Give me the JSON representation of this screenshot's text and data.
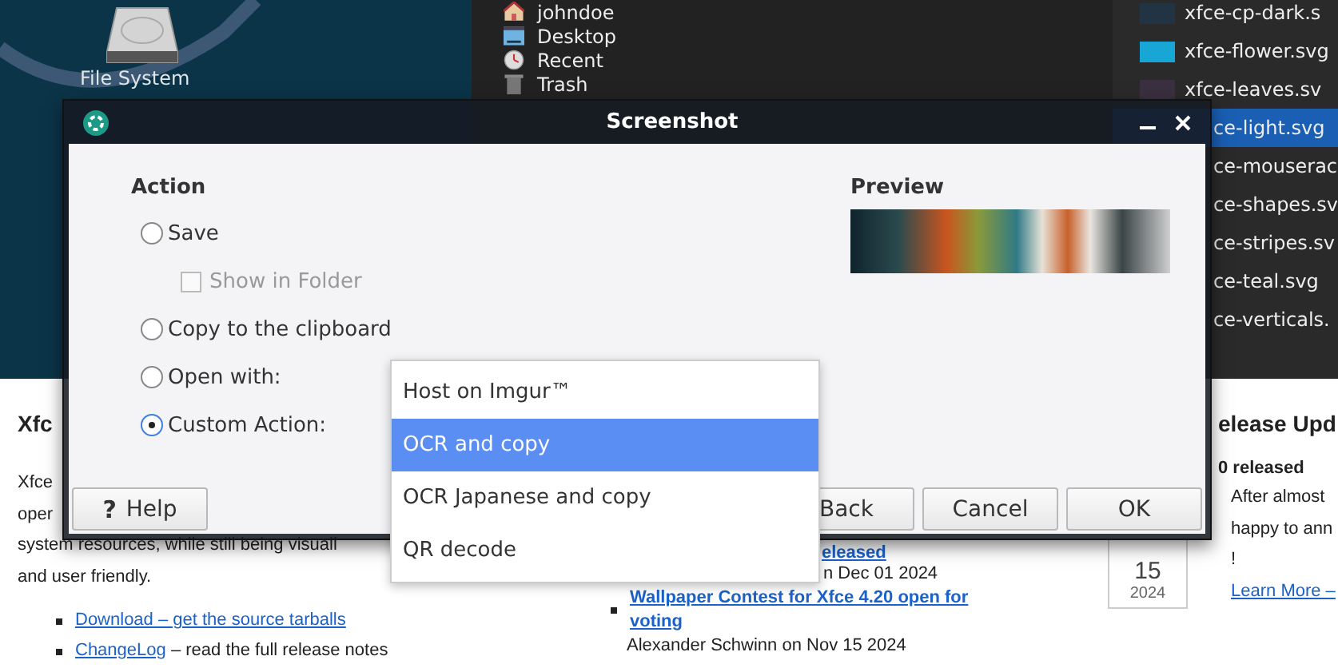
{
  "desktop": {
    "icons": [
      {
        "label": "File System"
      }
    ]
  },
  "file_manager": {
    "places": [
      {
        "label": "johndoe"
      },
      {
        "label": "Desktop"
      },
      {
        "label": "Recent"
      },
      {
        "label": "Trash"
      }
    ],
    "files": [
      {
        "name": "xfce-cp-dark.s",
        "kind": "full",
        "selected": false
      },
      {
        "name": "xfce-flower.svg",
        "kind": "full",
        "selected": false
      },
      {
        "name": "xfce-leaves.sv",
        "kind": "full",
        "selected": false
      },
      {
        "name": "ce-light.svg",
        "kind": "clipped",
        "selected": true
      },
      {
        "name": "ce-mouserac",
        "kind": "clipped",
        "selected": false
      },
      {
        "name": "ce-shapes.sv",
        "kind": "clipped",
        "selected": false
      },
      {
        "name": "ce-stripes.sv",
        "kind": "clipped",
        "selected": false
      },
      {
        "name": "ce-teal.svg",
        "kind": "clipped",
        "selected": false
      },
      {
        "name": "ce-verticals.",
        "kind": "clipped",
        "selected": false
      }
    ]
  },
  "web_page": {
    "left": {
      "heading": "Xfc",
      "paragraph_lines": [
        "Xfce",
        "oper",
        "system resources, while still being visuall",
        "and user friendly."
      ],
      "links": [
        {
          "link": "Download – get the source tarballs"
        },
        {
          "link": "ChangeLog",
          "rest": " – read the full release notes"
        }
      ]
    },
    "middle": {
      "cut_link": "eleased",
      "byline": "n Dec 01 2024",
      "news": [
        {
          "title": "Wallpaper Contest for Xfce 4.20 open for voting",
          "byline": "Alexander Schwinn on Nov 15 2024"
        }
      ]
    },
    "right": {
      "heading": "elease Upd",
      "subheading": "0 released",
      "date_day": "15",
      "date_year": "2024",
      "text_lines": [
        "After almost",
        "happy to ann",
        "!"
      ],
      "link": "Learn More –"
    }
  },
  "dialog": {
    "title": "Screenshot",
    "action_heading": "Action",
    "options": [
      {
        "kind": "radio",
        "label": "Save",
        "selected": false
      },
      {
        "kind": "checkbox",
        "label": "Show in Folder",
        "checked": false,
        "disabled": true
      },
      {
        "kind": "radio",
        "label": "Copy to the clipboard",
        "selected": false
      },
      {
        "kind": "radio",
        "label": "Open with:",
        "selected": false
      },
      {
        "kind": "radio",
        "label": "Custom Action:",
        "selected": true
      }
    ],
    "preview_heading": "Preview",
    "buttons": [
      {
        "kind": "help",
        "glyph": "?",
        "label": "Help"
      },
      {
        "kind": "plain",
        "label": "Back"
      },
      {
        "kind": "plain",
        "label": "Cancel"
      },
      {
        "kind": "plain",
        "label": "OK"
      }
    ]
  },
  "menu": {
    "items": [
      {
        "label": "Host on Imgur™",
        "selected": false
      },
      {
        "label": "OCR and copy",
        "selected": true
      },
      {
        "label": "OCR Japanese and copy",
        "selected": false
      },
      {
        "label": "QR decode",
        "selected": false
      }
    ]
  }
}
